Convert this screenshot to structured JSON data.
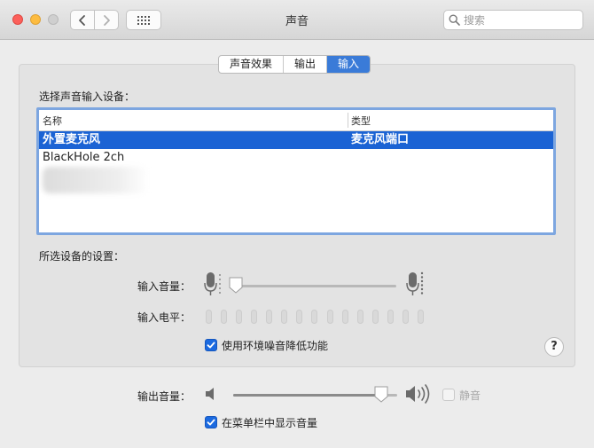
{
  "window": {
    "title": "声音"
  },
  "search": {
    "placeholder": "搜索"
  },
  "tabs": [
    {
      "label": "声音效果",
      "active": false
    },
    {
      "label": "输出",
      "active": false
    },
    {
      "label": "输入",
      "active": true
    }
  ],
  "input_section": {
    "heading": "选择声音输入设备：",
    "columns": {
      "name": "名称",
      "type": "类型"
    },
    "devices": [
      {
        "name": "外置麦克风",
        "type": "麦克风端口",
        "selected": true
      },
      {
        "name": "BlackHole 2ch",
        "type": "",
        "selected": false
      }
    ]
  },
  "settings": {
    "heading": "所选设备的设置：",
    "input_volume_label": "输入音量：",
    "input_volume_level": 0.02,
    "input_level_label": "输入电平：",
    "input_level_active_segments": 0,
    "noise_reduction_label": "使用环境噪音降低功能",
    "noise_reduction_checked": true
  },
  "output": {
    "volume_label": "输出音量：",
    "volume_level": 0.9,
    "mute_label": "静音",
    "mute_checked": false,
    "show_in_menubar_label": "在菜单栏中显示音量",
    "show_in_menubar_checked": true
  },
  "colors": {
    "accent": "#1b63d4",
    "close": "#fc605b",
    "minimize": "#fdbc40"
  },
  "icons": [
    "chevron-left-icon",
    "chevron-right-icon",
    "grid-icon",
    "search-icon",
    "microphone-icon",
    "speaker-low-icon",
    "speaker-high-icon",
    "help-icon"
  ]
}
